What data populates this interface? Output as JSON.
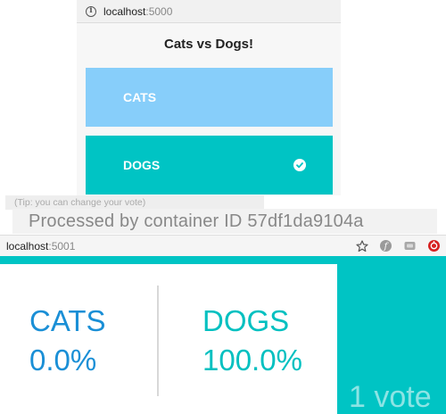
{
  "vote_window": {
    "url_host": "localhost",
    "url_port": ":5000",
    "title": "Cats vs Dogs!",
    "options": [
      {
        "label": "CATS",
        "selected": false,
        "color": "#87cefa"
      },
      {
        "label": "DOGS",
        "selected": true,
        "color": "#00c4c4"
      }
    ],
    "tip": "(Tip: you can change your vote)",
    "processed_by": "Processed by container ID  57df1da9104a"
  },
  "result_window": {
    "url_host": "localhost",
    "url_port": ":5001",
    "results": [
      {
        "label": "CATS",
        "percent": "0.0%",
        "color": "#1a8fd6"
      },
      {
        "label": "DOGS",
        "percent": "100.0%",
        "color": "#00c0c0"
      }
    ],
    "vote_count": "1 vote",
    "accent_color": "#00c4c4",
    "toolbar_icons": [
      "star-icon",
      "extension-f-icon",
      "extension-box-icon",
      "extension-red-icon"
    ]
  }
}
